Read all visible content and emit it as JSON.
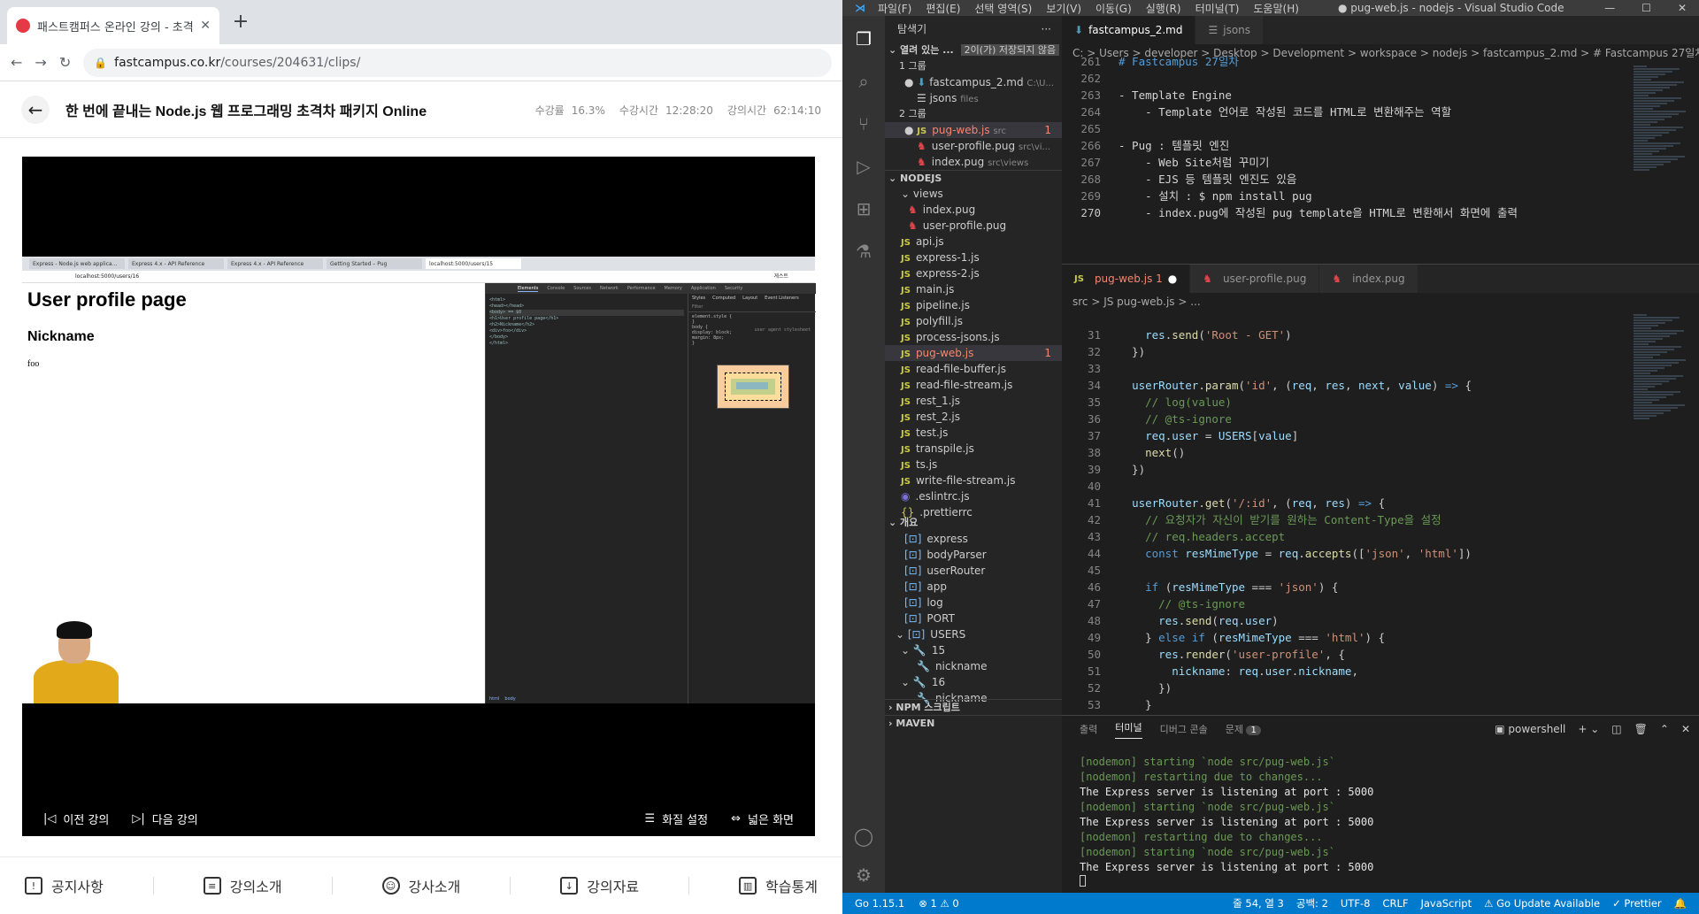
{
  "browser": {
    "tab_title": "패스트캠퍼스 온라인 강의 - 초격",
    "url_domain": "fastcampus.co.kr",
    "url_path": "/courses/204631/clips/",
    "course_title": "한 번에 끝내는 Node.js 웹 프로그래밍 초격차 패키지 Online",
    "stats": [
      {
        "label": "수강률",
        "value": "16.3%"
      },
      {
        "label": "수강시간",
        "value": "12:28:20"
      },
      {
        "label": "강의시간",
        "value": "62:14:10"
      }
    ],
    "inner_tabs": [
      "Express - Node.js web applica...",
      "Express 4.x - API Reference",
      "Express 4.x - API Reference",
      "Getting Started – Pug",
      "localhost:5000/users/15"
    ],
    "inner_url": "localhost:5000/users/16",
    "inner_profile_label": "게스트",
    "page_h1": "User profile page",
    "page_h2": "Nickname",
    "page_p": "foo",
    "devtools_tabs": [
      "Elements",
      "Console",
      "Sources",
      "Network",
      "Performance",
      "Memory",
      "Application",
      "Security"
    ],
    "devtools_elements": [
      "<html>",
      "  <head></head>",
      "  <body> == $0",
      "    <h1>User profile page</h1>",
      "    <h2>Nickname</h2>",
      "    <div>foo</div>",
      "  </body>",
      "</html>"
    ],
    "devtools_style_tabs": [
      "Styles",
      "Computed",
      "Layout",
      "Event Listeners"
    ],
    "devtools_filter": "Filter",
    "devtools_rules": [
      "element.style {",
      "}",
      "body {",
      "  display: block;",
      "  margin: 8px;",
      "}"
    ],
    "devtools_user_agent": "user agent stylesheet",
    "devtools_footer": [
      "html",
      "body"
    ],
    "controls": {
      "prev": "이전 강의",
      "next": "다음 강의",
      "quality": "화질 설정",
      "wide": "넓은 화면"
    },
    "bottom_nav": [
      "공지사항",
      "강의소개",
      "강사소개",
      "강의자료",
      "학습통계"
    ]
  },
  "vscode": {
    "menu": [
      "파일(F)",
      "편집(E)",
      "선택 영역(S)",
      "보기(V)",
      "이동(G)",
      "실행(R)",
      "터미널(T)",
      "도움말(H)"
    ],
    "window_title": "● pug-web.js - nodejs - Visual Studio Code",
    "explorer_title": "탐색기",
    "open_editors_label": "열려 있는 ...",
    "unsaved_badge": "2이(가) 저장되지 않음",
    "group1": "1 그룹",
    "group2": "2 그룹",
    "open_editors": [
      {
        "name": "fastcampus_2.md",
        "desc": "C:\\U..."
      },
      {
        "name": "jsons",
        "desc": "files"
      },
      {
        "name": "pug-web.js",
        "desc": "src",
        "badge": "1"
      },
      {
        "name": "user-profile.pug",
        "desc": "src\\vi..."
      },
      {
        "name": "index.pug",
        "desc": "src\\views"
      }
    ],
    "project": "NODEJS",
    "tree": [
      "views",
      "index.pug",
      "user-profile.pug",
      "api.js",
      "express-1.js",
      "express-2.js",
      "main.js",
      "pipeline.js",
      "polyfill.js",
      "process-jsons.js",
      "pug-web.js",
      "read-file-buffer.js",
      "read-file-stream.js",
      "rest_1.js",
      "rest_2.js",
      "test.js",
      "transpile.js",
      "ts.js",
      "write-file-stream.js",
      ".eslintrc.js",
      ".prettierrc"
    ],
    "tree_badge": "1",
    "outline_title": "개요",
    "outline": [
      "express",
      "bodyParser",
      "userRouter",
      "app",
      "log",
      "PORT",
      "USERS",
      "15",
      "nickname",
      "16",
      "nickname"
    ],
    "npm_scripts": "NPM 스크립트",
    "maven": "MAVEN",
    "editor1_tabs": [
      "fastcampus_2.md",
      "jsons"
    ],
    "editor1_crumbs": "C: > Users > developer > Desktop > Development > workspace > nodejs > fastcampus_2.md > # Fastcampus 27일차",
    "editor1_lines": [
      {
        "n": "261",
        "t": "# Fastcampus 27일차"
      },
      {
        "n": "262",
        "t": ""
      },
      {
        "n": "263",
        "t": "- Template Engine"
      },
      {
        "n": "264",
        "t": "    - Template 언어로 작성된 코드를 HTML로 변환해주는 역할"
      },
      {
        "n": "265",
        "t": ""
      },
      {
        "n": "266",
        "t": "- Pug : 템플릿 엔진"
      },
      {
        "n": "267",
        "t": "    - Web Site처럼 꾸미기"
      },
      {
        "n": "268",
        "t": "    - EJS 등 템플릿 엔진도 있음"
      },
      {
        "n": "269",
        "t": "    - 설치 : $ npm install pug"
      },
      {
        "n": "270",
        "t": "    - index.pug에 작성된 pug template을 HTML로 변환해서 화면에 출력"
      }
    ],
    "editor2_tabs": [
      "pug-web.js 1",
      "user-profile.pug",
      "index.pug"
    ],
    "editor2_crumbs": "src > JS pug-web.js > ...",
    "terminal_tabs": [
      "출력",
      "터미널",
      "디버그 콘솔",
      "문제"
    ],
    "problems_count": "1",
    "terminal_shell": "powershell",
    "terminal_lines": [
      "[nodemon] starting `node src/pug-web.js`",
      "[nodemon] restarting due to changes...",
      "The Express server is listening at port : 5000",
      "[nodemon] starting `node src/pug-web.js`",
      "The Express server is listening at port : 5000",
      "[nodemon] restarting due to changes...",
      "[nodemon] starting `node src/pug-web.js`",
      "The Express server is listening at port : 5000"
    ],
    "status_left": [
      "Go 1.15.1",
      "⊗ 1 ⚠ 0"
    ],
    "status_right": [
      "줄 54, 열 3",
      "공백: 2",
      "UTF-8",
      "CRLF",
      "JavaScript",
      "Go Update Available",
      "Prettier"
    ]
  }
}
